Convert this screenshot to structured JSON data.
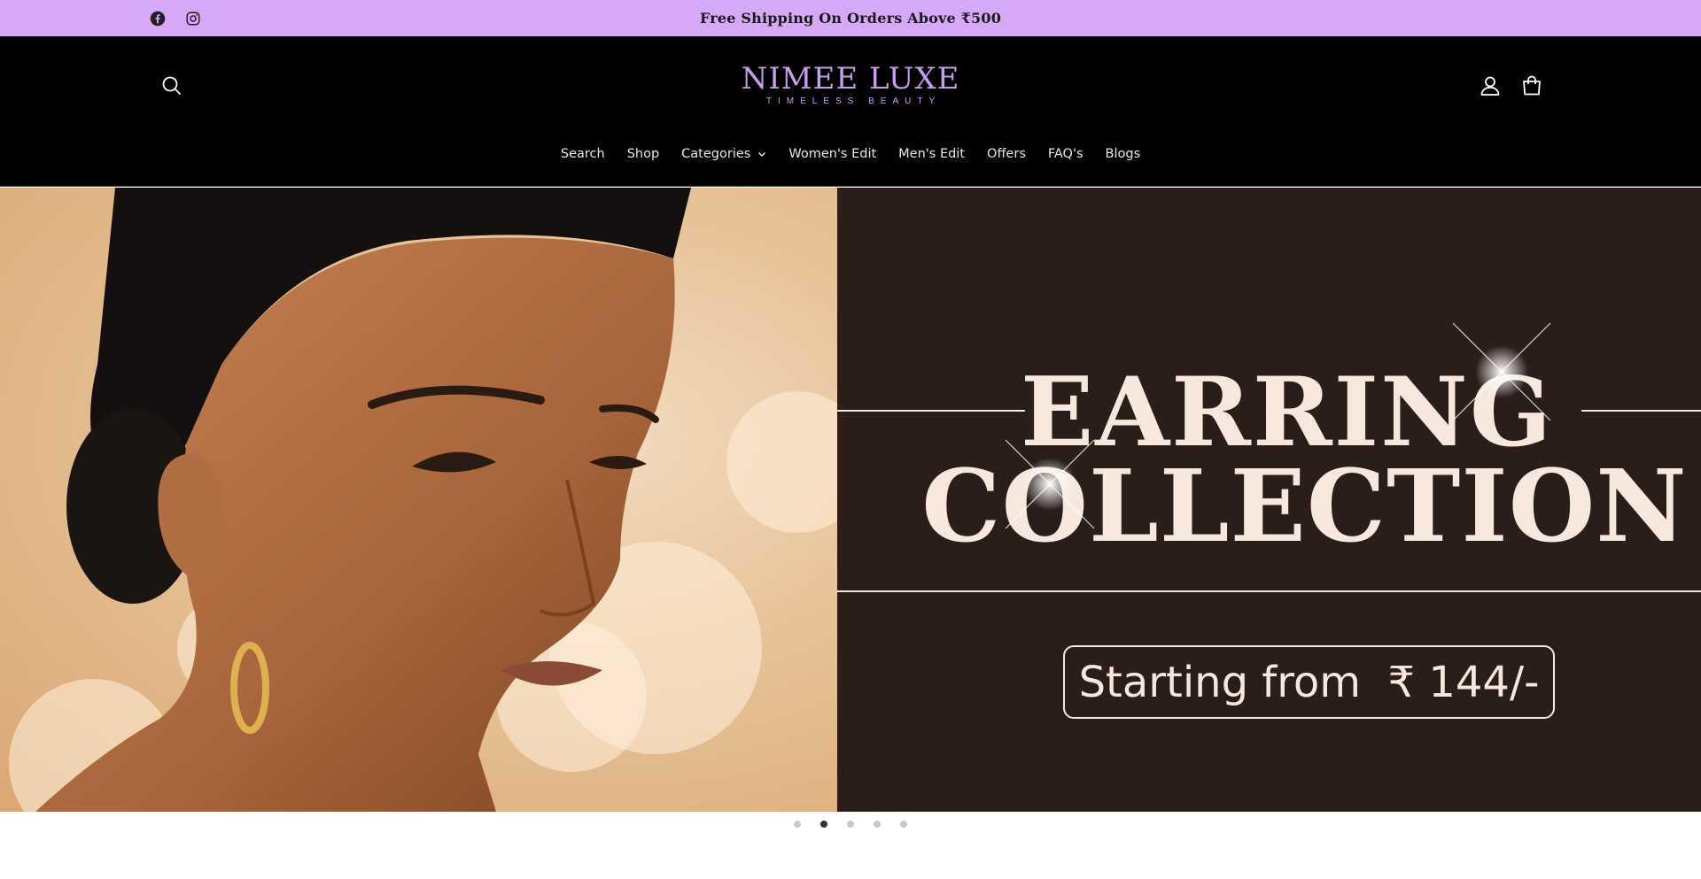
{
  "announcement": {
    "text": "Free Shipping On Orders Above ₹500",
    "social_icons": [
      "facebook-icon",
      "instagram-icon"
    ]
  },
  "header": {
    "logo_main": "NIMEE LUXE",
    "logo_sub": "TIMELESS BEAUTY",
    "icons": [
      "search-icon",
      "account-icon",
      "cart-icon"
    ]
  },
  "nav": {
    "items": [
      {
        "label": "Search"
      },
      {
        "label": "Shop"
      },
      {
        "label": "Categories",
        "has_dropdown": true
      },
      {
        "label": "Women's Edit"
      },
      {
        "label": "Men's Edit"
      },
      {
        "label": "Offers"
      },
      {
        "label": "FAQ's"
      },
      {
        "label": "Blogs"
      }
    ]
  },
  "hero": {
    "title_line1": "EARRING",
    "title_line2": "COLLECTION",
    "price_text": "Starting from  ₹ 144/-",
    "slide_count": 5,
    "active_slide": 2
  },
  "colors": {
    "announce_bg": "#d6a8f8",
    "header_bg": "#000000",
    "logo": "#c89df0",
    "hero_right_bg": "#2b1d1a",
    "hero_text": "#f6e8dc"
  }
}
